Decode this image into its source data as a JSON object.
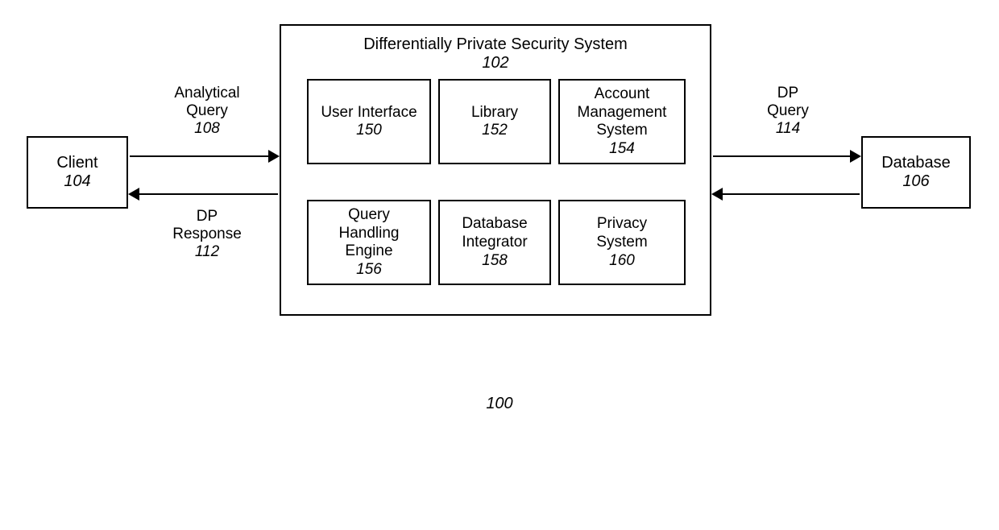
{
  "diagram_number": "100",
  "client": {
    "title": "Client",
    "num": "104"
  },
  "database": {
    "title": "Database",
    "num": "106"
  },
  "dps": {
    "title": "Differentially Private Security System",
    "num": "102",
    "modules": {
      "ui": {
        "title": "User Interface",
        "num": "150"
      },
      "lib": {
        "title": "Library",
        "num": "152"
      },
      "ams": {
        "title": "Account\nManagement\nSystem",
        "num": "154"
      },
      "qhe": {
        "title": "Query\nHandling\nEngine",
        "num": "156"
      },
      "dbi": {
        "title": "Database\nIntegrator",
        "num": "158"
      },
      "ps": {
        "title": "Privacy\nSystem",
        "num": "160"
      }
    }
  },
  "arrows": {
    "analytical_query": {
      "title": "Analytical\nQuery",
      "num": "108"
    },
    "dp_response": {
      "title": "DP\nResponse",
      "num": "112"
    },
    "dp_query": {
      "title": "DP\nQuery",
      "num": "114"
    }
  }
}
